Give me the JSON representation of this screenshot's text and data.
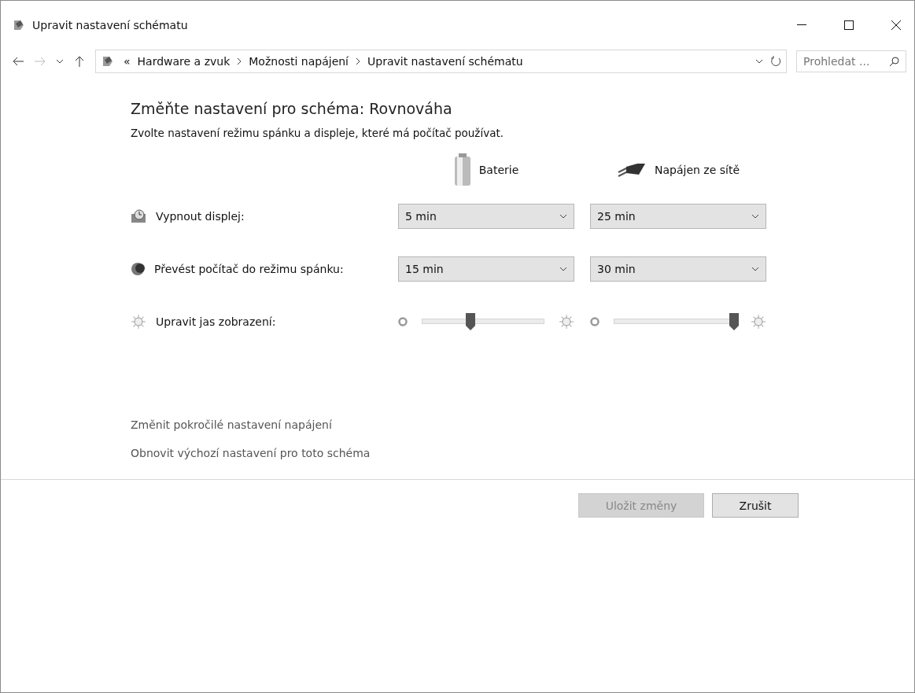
{
  "window": {
    "title": "Upravit nastavení schématu"
  },
  "address_bar": {
    "breadcrumb": [
      "Hardware a zvuk",
      "Možnosti napájení",
      "Upravit nastavení schématu"
    ],
    "overflow": "«"
  },
  "search": {
    "placeholder": "Prohledat ..."
  },
  "heading": "Změňte nastavení pro schéma: Rovnováha",
  "subheading": "Zvolte nastavení režimu spánku a displeje, které má počítač používat.",
  "columns": [
    {
      "label": "Baterie",
      "kind": "battery"
    },
    {
      "label": "Napájen ze sítě",
      "kind": "plug"
    }
  ],
  "settings": [
    {
      "label": "Vypnout displej:",
      "kind": "dropdown",
      "values": [
        "5 min",
        "25 min"
      ]
    },
    {
      "label": "Převést počítač do režimu spánku:",
      "kind": "dropdown",
      "values": [
        "15 min",
        "30 min"
      ]
    },
    {
      "label": "Upravit jas zobrazení:",
      "kind": "slider",
      "levels": [
        {
          "level": 0.4
        },
        {
          "level": 0.98
        }
      ]
    }
  ],
  "links": [
    "Změnit pokročilé nastavení napájení",
    "Obnovit výchozí nastavení pro toto schéma"
  ],
  "buttons": [
    {
      "label": "Uložit změny",
      "disabled": true
    },
    {
      "label": "Zrušit",
      "disabled": false
    }
  ]
}
